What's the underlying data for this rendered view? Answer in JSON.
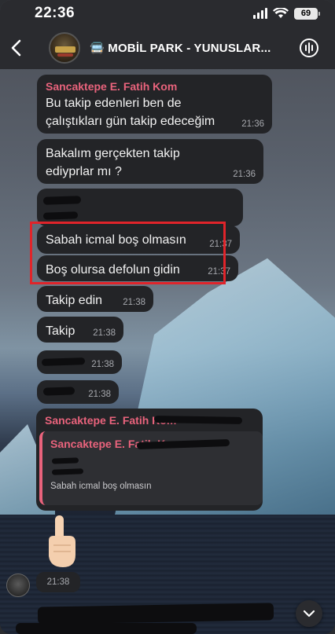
{
  "status_bar": {
    "time": "22:36",
    "battery": "69"
  },
  "header": {
    "title": "🚍 MOBİL PARK - YUNUSLAR..."
  },
  "messages": [
    {
      "sender": "Sancaktepe E. Fatih Kom",
      "text": "Bu takip edenleri ben de çalıştıkları gün takip edeceğim",
      "time": "21:36"
    },
    {
      "text": "Bakalım gerçekten takip ediyprlar mı ?",
      "time": "21:36"
    },
    {
      "text": "Sabah icmal boş olmasın",
      "time": "21:37"
    },
    {
      "text": "Boş olursa defolun gidin",
      "time": "21:37"
    },
    {
      "text": "Takip edin",
      "time": "21:38"
    },
    {
      "text": "Takip",
      "time": "21:38"
    },
    {
      "time": "21:38"
    },
    {
      "time": "21:38"
    },
    {
      "sender": "Sancaktepe E. Fatih Kom"
    }
  ],
  "reply": {
    "quoted_sender": "Sancaktepe E. Fatih Kom",
    "quoted_text": "Sabah icmal boş olmasın"
  },
  "last_message": {
    "time": "21:38"
  },
  "colors": {
    "sender_name": "#e9637c",
    "bubble": "#232427",
    "highlight": "#e0242a"
  }
}
